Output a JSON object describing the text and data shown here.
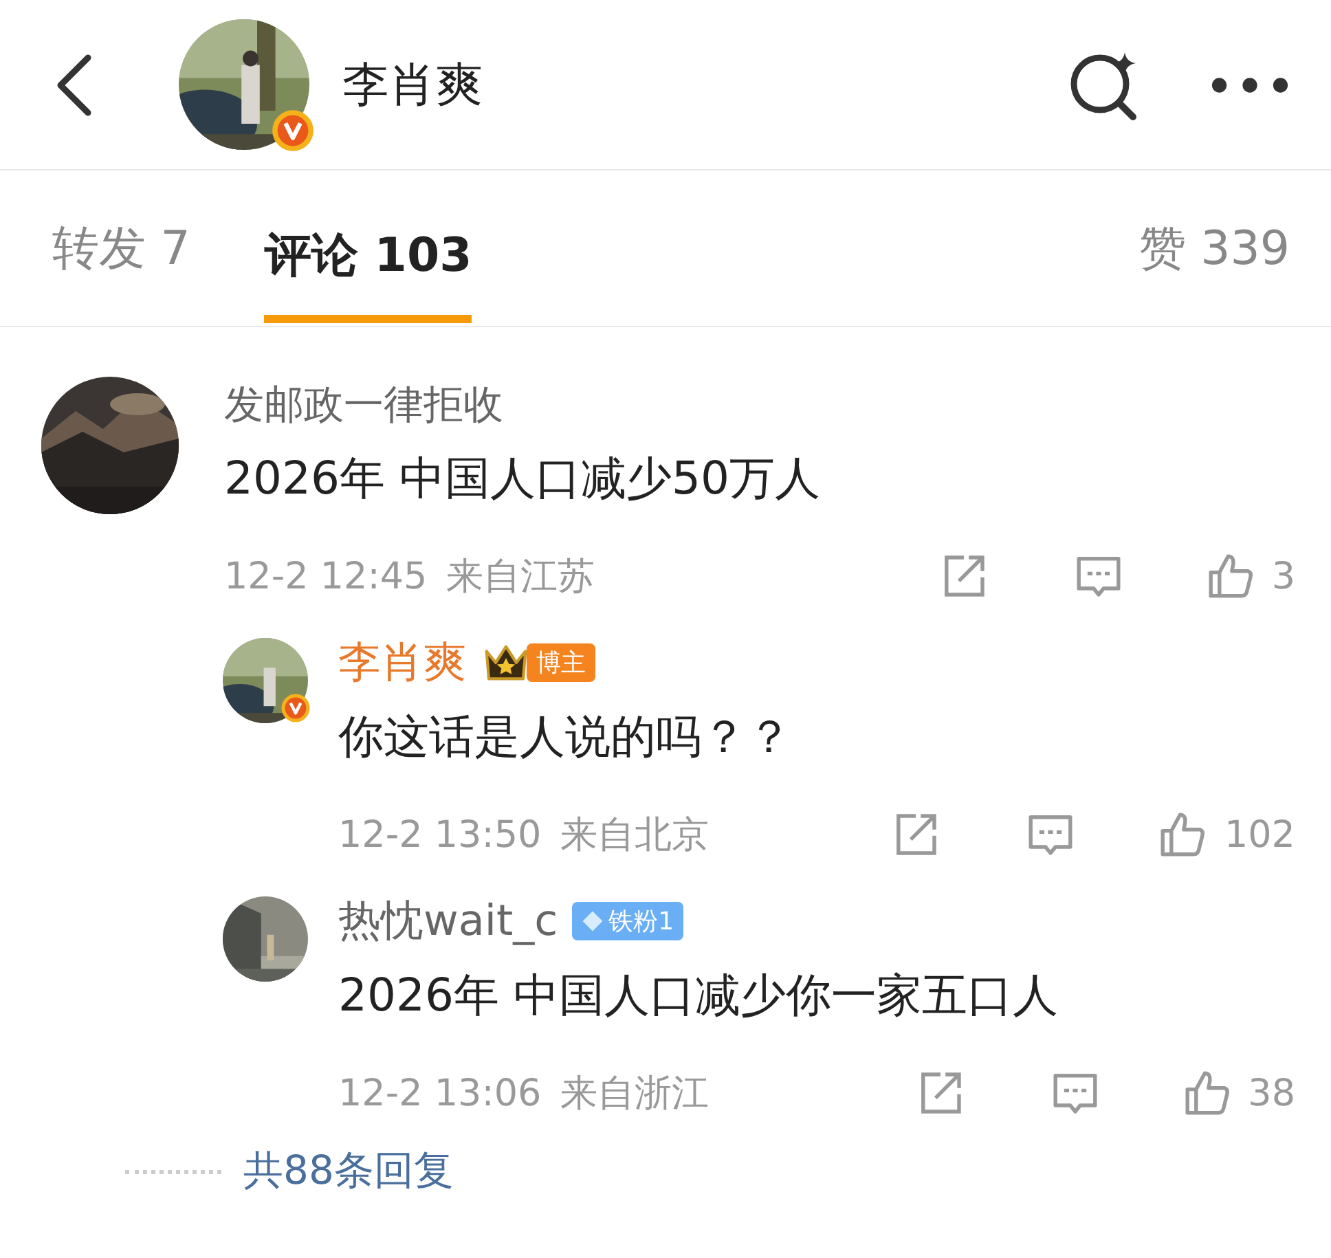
{
  "header": {
    "name": "李肖爽",
    "verified": true
  },
  "tabs": [
    {
      "label": "转发 7",
      "selected": false
    },
    {
      "label": "评论 103",
      "selected": true
    }
  ],
  "likes": "赞 339",
  "comments": [
    {
      "user": "发邮政一律拒收",
      "text": "2026年 中国人口减少50万人",
      "time": "12-2 12:45",
      "location": "来自江苏",
      "like_count": "3",
      "replies": [
        {
          "user": "李肖爽",
          "author": true,
          "verified": true,
          "badge": {
            "kind": "author",
            "label": "博主"
          },
          "text": "你这话是人说的吗？？",
          "time": "12-2 13:50",
          "location": "来自北京",
          "like_count": "102"
        },
        {
          "user": "热忱wait_c",
          "author": false,
          "badge": {
            "kind": "fan",
            "label": "铁粉1"
          },
          "text": "2026年 中国人口减少你一家五口人",
          "time": "12-2 13:06",
          "location": "来自浙江",
          "like_count": "38"
        }
      ],
      "more_replies": "共88条回复"
    }
  ]
}
